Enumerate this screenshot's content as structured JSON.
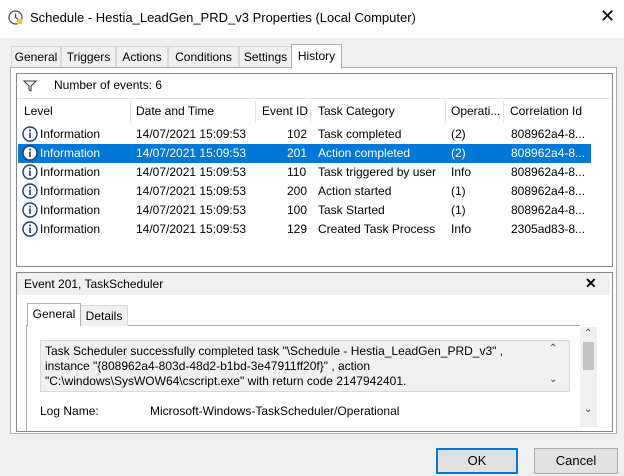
{
  "window": {
    "title": "Schedule - Hestia_LeadGen_PRD_v3 Properties (Local Computer)",
    "close_glyph": "✕"
  },
  "tabs": [
    "General",
    "Triggers",
    "Actions",
    "Conditions",
    "Settings",
    "History"
  ],
  "active_tab": "History",
  "history": {
    "filter_label": "Number of events: 6",
    "columns": [
      "Level",
      "Date and Time",
      "Event ID",
      "Task Category",
      "Operati...",
      "Correlation Id"
    ],
    "rows": [
      {
        "level": "Information",
        "datetime": "14/07/2021 15:09:53",
        "event_id": "102",
        "category": "Task completed",
        "opcode": "(2)",
        "correlation": "808962a4-8..."
      },
      {
        "level": "Information",
        "datetime": "14/07/2021 15:09:53",
        "event_id": "201",
        "category": "Action completed",
        "opcode": "(2)",
        "correlation": "808962a4-8..."
      },
      {
        "level": "Information",
        "datetime": "14/07/2021 15:09:53",
        "event_id": "110",
        "category": "Task triggered by user",
        "opcode": "Info",
        "correlation": "808962a4-8..."
      },
      {
        "level": "Information",
        "datetime": "14/07/2021 15:09:53",
        "event_id": "200",
        "category": "Action started",
        "opcode": "(1)",
        "correlation": "808962a4-8..."
      },
      {
        "level": "Information",
        "datetime": "14/07/2021 15:09:53",
        "event_id": "100",
        "category": "Task Started",
        "opcode": "(1)",
        "correlation": "808962a4-8..."
      },
      {
        "level": "Information",
        "datetime": "14/07/2021 15:09:53",
        "event_id": "129",
        "category": "Created Task Process",
        "opcode": "Info",
        "correlation": "2305ad83-8..."
      }
    ],
    "selected_index": 1
  },
  "detail": {
    "title": "Event 201, TaskScheduler",
    "close_glyph": "✕",
    "subtabs": [
      "General",
      "Details"
    ],
    "active_subtab": "General",
    "description": "Task Scheduler successfully completed task \"\\Schedule - Hestia_LeadGen_PRD_v3\" , instance \"{808962a4-803d-48d2-b1bd-3e47911ff20f}\" , action \"C:\\windows\\SysWOW64\\cscript.exe\" with return code 2147942401.",
    "log_name_label": "Log Name:",
    "log_name_value": "Microsoft-Windows-TaskScheduler/Operational"
  },
  "buttons": {
    "ok": "OK",
    "cancel": "Cancel"
  },
  "colors": {
    "accent": "#0078d7",
    "selection_text": "#ffffff"
  }
}
